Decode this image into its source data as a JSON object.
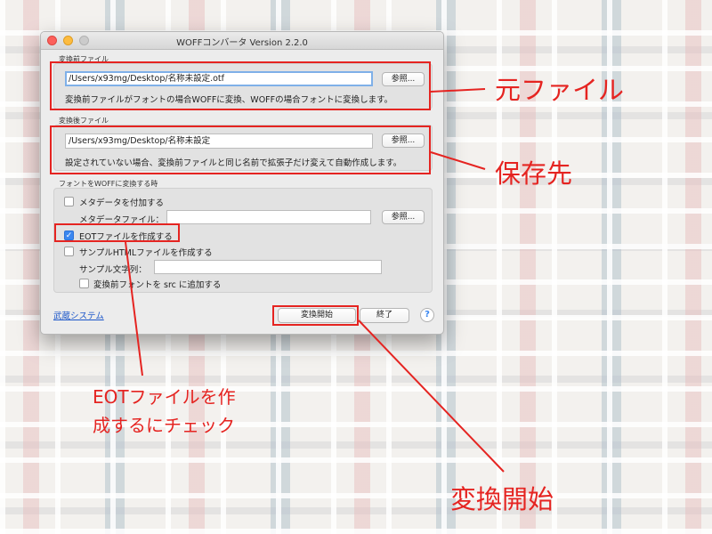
{
  "window": {
    "title": "WOFFコンバータ Version 2.2.0"
  },
  "source": {
    "label": "変換前ファイル",
    "value": "/Users/x93mg/Desktop/名称未設定.otf",
    "browse": "参照...",
    "note": "変換前ファイルがフォントの場合WOFFに変換、WOFFの場合フォントに変換します。"
  },
  "dest": {
    "label": "変換後ファイル",
    "value": "/Users/x93mg/Desktop/名称未設定",
    "browse": "参照...",
    "note": "設定されていない場合、変換前ファイルと同じ名前で拡張子だけ変えて自動作成します。"
  },
  "woff_options": {
    "label": "フォントをWOFFに変換する時",
    "metadata_check": "メタデータを付加する",
    "metadata_checked": false,
    "metadata_file_label": "メタデータファイル：",
    "metadata_file_value": "",
    "metadata_browse": "参照...",
    "eot_check": "EOTファイルを作成する",
    "eot_checked": true,
    "sample_html_check": "サンプルHTMLファイルを作成する",
    "sample_html_checked": false,
    "sample_string_label": "サンプル文字列：",
    "sample_string_value": "",
    "add_src_check": "変換前フォントを src に追加する",
    "add_src_checked": false
  },
  "footer": {
    "link": "武蔵システム",
    "convert": "変換開始",
    "quit": "終了",
    "help": "?"
  },
  "annotations": {
    "source_file": "元ファイル",
    "save_dest": "保存先",
    "check_eot": "EOTファイルを作成するにチェック",
    "start_convert": "変換開始",
    "color": "#e52421"
  }
}
